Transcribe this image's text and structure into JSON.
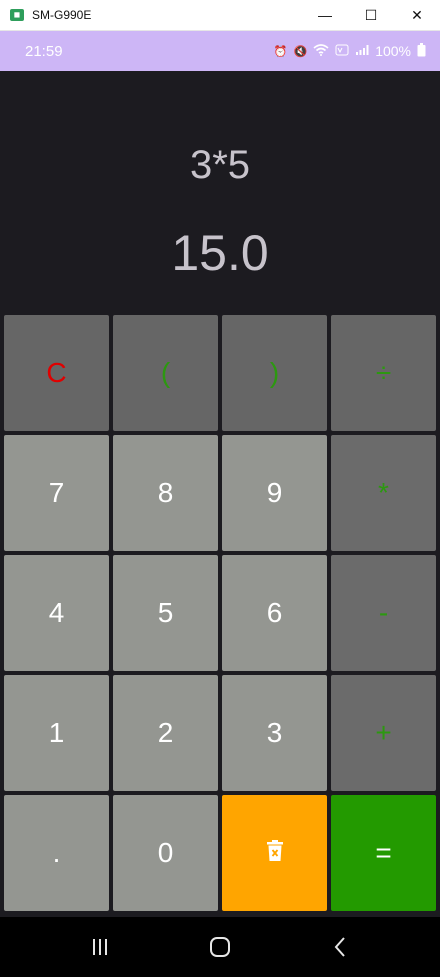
{
  "window": {
    "title": "SM-G990E",
    "app_icon_glyph": "◼",
    "minimize_glyph": "—",
    "maximize_glyph": "☐",
    "close_glyph": "✕"
  },
  "status_bar": {
    "time": "21:59",
    "battery": "100%",
    "icons": [
      "alarm-icon",
      "mute-icon",
      "wifi-icon",
      "volte-icon",
      "signal-icon",
      "battery-icon"
    ]
  },
  "display": {
    "expression": "3*5",
    "result": "15.0"
  },
  "keys": [
    {
      "name": "clear-button",
      "label": "C",
      "style": "fn clear"
    },
    {
      "name": "open-paren-button",
      "label": "(",
      "style": "fn green-text"
    },
    {
      "name": "close-paren-button",
      "label": ")",
      "style": "fn green-text"
    },
    {
      "name": "divide-button",
      "label": "÷",
      "style": "fn green-text"
    },
    {
      "name": "digit-7-button",
      "label": "7",
      "style": "num"
    },
    {
      "name": "digit-8-button",
      "label": "8",
      "style": "num"
    },
    {
      "name": "digit-9-button",
      "label": "9",
      "style": "num"
    },
    {
      "name": "multiply-button",
      "label": "*",
      "style": "op green-text"
    },
    {
      "name": "digit-4-button",
      "label": "4",
      "style": "num"
    },
    {
      "name": "digit-5-button",
      "label": "5",
      "style": "num"
    },
    {
      "name": "digit-6-button",
      "label": "6",
      "style": "num"
    },
    {
      "name": "minus-button",
      "label": "-",
      "style": "op green-text"
    },
    {
      "name": "digit-1-button",
      "label": "1",
      "style": "num"
    },
    {
      "name": "digit-2-button",
      "label": "2",
      "style": "num"
    },
    {
      "name": "digit-3-button",
      "label": "3",
      "style": "num"
    },
    {
      "name": "plus-button",
      "label": "+",
      "style": "op green-text"
    },
    {
      "name": "decimal-button",
      "label": ".",
      "style": "num"
    },
    {
      "name": "digit-0-button",
      "label": "0",
      "style": "num"
    },
    {
      "name": "delete-button",
      "label": "",
      "icon": "trash-icon",
      "style": "delete"
    },
    {
      "name": "equals-button",
      "label": "=",
      "style": "equals"
    }
  ],
  "nav_bar": {
    "recents_icon": "recents-icon",
    "home_icon": "home-icon",
    "back_icon": "back-icon"
  },
  "colors": {
    "status_bar": "#cdb6f6",
    "display_bg": "#1c1b20",
    "function_key": "#666666",
    "operator_key": "#6b6b6b",
    "number_key": "#949691",
    "operator_text": "#2c9810",
    "clear_text": "#e00000",
    "delete_key": "#ffa500",
    "equals_key": "#239a00"
  }
}
